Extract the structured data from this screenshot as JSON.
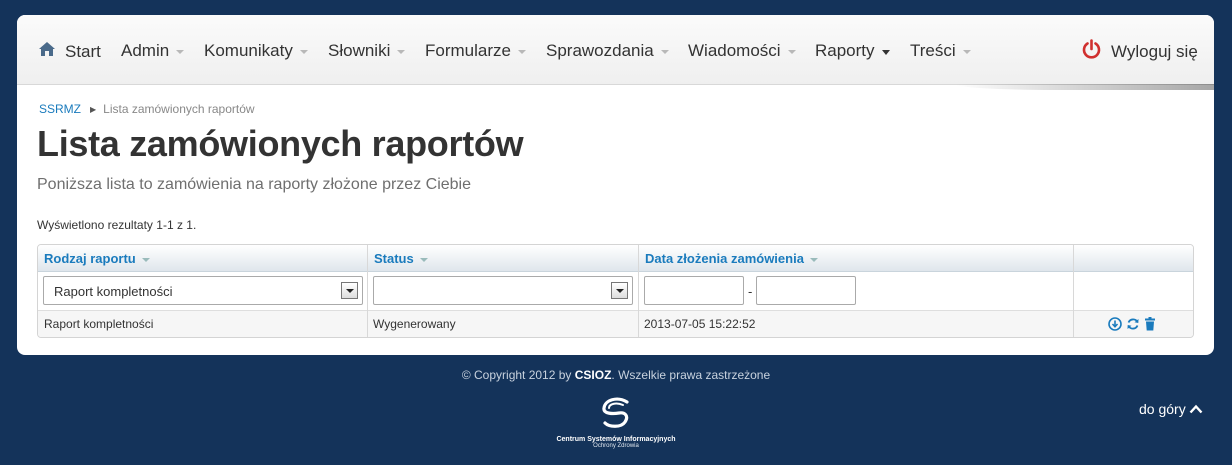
{
  "nav": {
    "items": [
      {
        "label": "Start"
      },
      {
        "label": "Admin"
      },
      {
        "label": "Komunikaty"
      },
      {
        "label": "Słowniki"
      },
      {
        "label": "Formularze"
      },
      {
        "label": "Sprawozdania"
      },
      {
        "label": "Wiadomości"
      },
      {
        "label": "Raporty"
      },
      {
        "label": "Treści"
      }
    ],
    "logout": "Wyloguj się"
  },
  "breadcrumb": {
    "root": "SSRMZ",
    "current": "Lista zamówionych raportów"
  },
  "page": {
    "title": "Lista zamówionych raportów",
    "subtitle": "Poniższa lista to zamówienia na raporty złożone przez Ciebie",
    "results": "Wyświetlono rezultaty 1-1 z 1."
  },
  "grid": {
    "columns": [
      "Rodzaj raportu",
      "Status",
      "Data złożenia zamówienia"
    ],
    "filters": {
      "type_selected": "Raport kompletności",
      "status_selected": "",
      "date_separator": "-"
    },
    "rows": [
      {
        "type": "Raport kompletności",
        "status": "Wygenerowany",
        "date": "2013-07-05 15:22:52",
        "actions": [
          "download-icon",
          "refresh-icon",
          "trash-icon"
        ]
      }
    ]
  },
  "footer": {
    "copyright_pre": "© Copyright 2012 by ",
    "copyright_org": "CSIOZ",
    "copyright_post": ". Wszelkie prawa zastrzeżone",
    "logo_line1": "Centrum Systemów Informacyjnych",
    "logo_line2": "Ochrony Zdrowia",
    "to_top": "do góry"
  },
  "colors": {
    "background": "#14335a",
    "link": "#1a7bbd",
    "power": "#d0302f"
  }
}
